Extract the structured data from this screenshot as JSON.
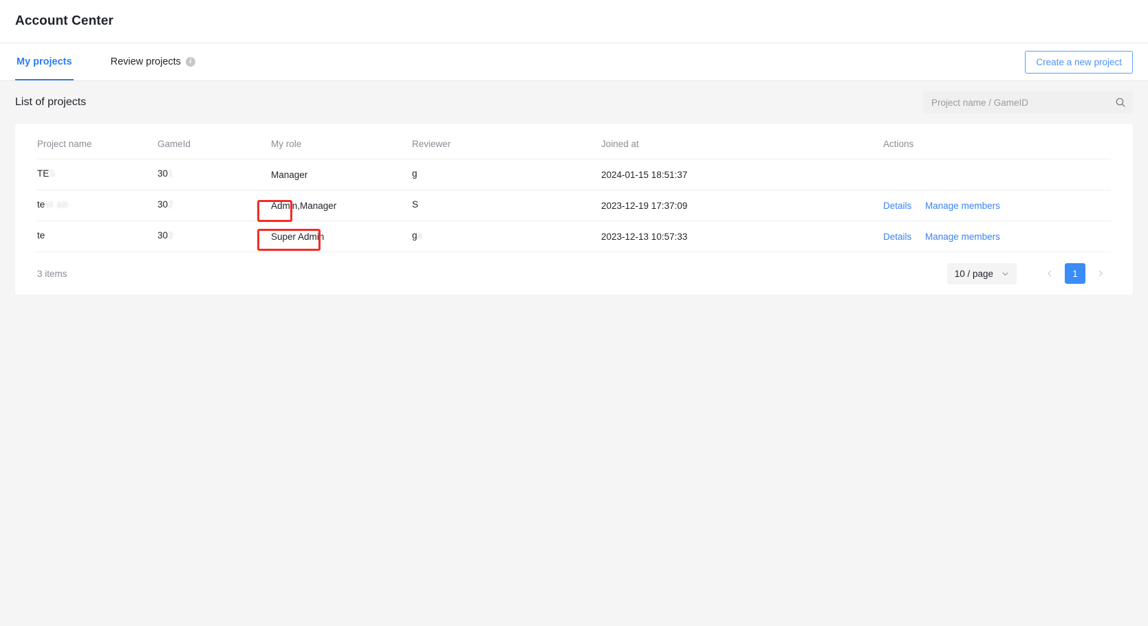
{
  "header": {
    "title": "Account Center"
  },
  "tabs": [
    {
      "label": "My projects",
      "active": true
    },
    {
      "label": "Review projects",
      "active": false,
      "info_icon": "info-icon"
    }
  ],
  "toolbar": {
    "create_label": "Create a new project"
  },
  "list": {
    "title": "List of projects",
    "search_placeholder": "Project name / GameID",
    "search_value": "",
    "search_icon": "search-icon"
  },
  "table": {
    "columns": [
      "Project name",
      "GameId",
      "My role",
      "Reviewer",
      "Joined at",
      "Actions"
    ],
    "rows": [
      {
        "project_name": "TE",
        "project_name_tail": "S",
        "game_id": "30",
        "game_id_tail": "1",
        "my_role": "Manager",
        "reviewer": "g",
        "reviewer_tail": "",
        "joined_at": "2024-01-15 18:51:37",
        "actions": []
      },
      {
        "project_name": "te",
        "project_name_tail": "st ab",
        "game_id": "30",
        "game_id_tail": "2",
        "my_role": "Admin,Manager",
        "reviewer": "S",
        "reviewer_tail": "",
        "joined_at": "2023-12-19 17:37:09",
        "actions": [
          "Details",
          "Manage members"
        ]
      },
      {
        "project_name": "te",
        "project_name_tail": "",
        "game_id": "30",
        "game_id_tail": "3",
        "my_role": "Super Admin",
        "reviewer": "g",
        "reviewer_tail": "a",
        "joined_at": "2023-12-13 10:57:33",
        "actions": [
          "Details",
          "Manage members"
        ]
      }
    ]
  },
  "footer": {
    "items_count": "3 items",
    "page_size": "10 / page",
    "page_size_icon": "chevron-down-icon",
    "prev_icon": "chevron-left-icon",
    "next_icon": "chevron-right-icon",
    "current_page": "1"
  },
  "annotations": [
    {
      "name": "highlight-admin-role",
      "target": "Admin"
    },
    {
      "name": "highlight-super-admin-role",
      "target": "Super Admin"
    }
  ],
  "colors": {
    "accent": "#3a8cf7",
    "link": "#3a82f6",
    "annotation": "#f42b22",
    "page_bg": "#f5f5f5"
  }
}
